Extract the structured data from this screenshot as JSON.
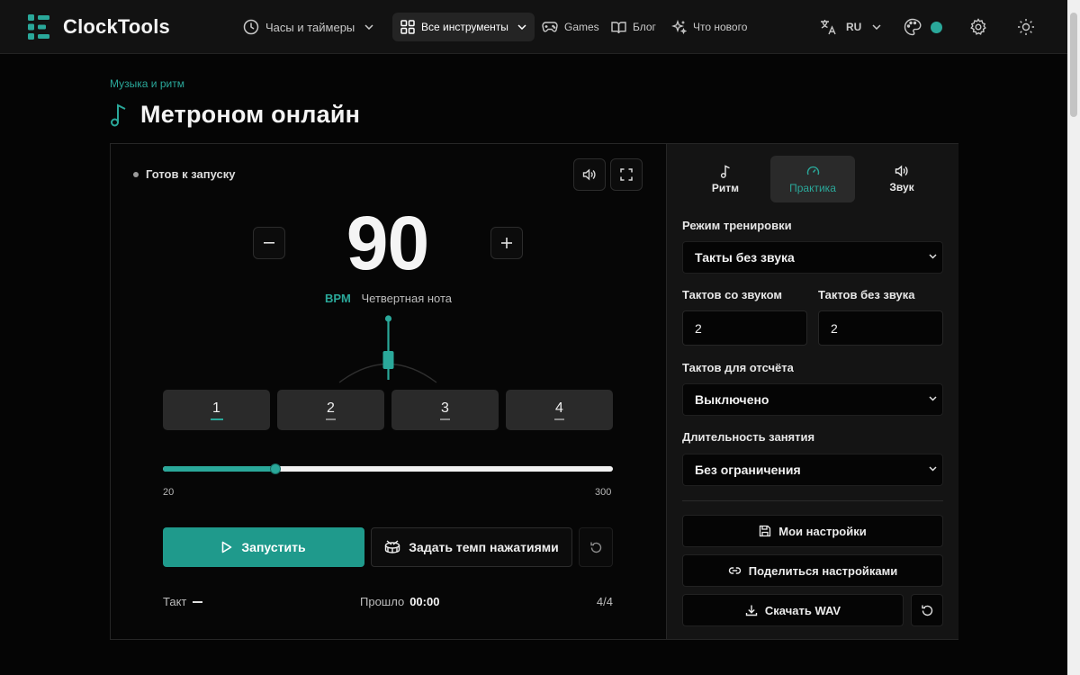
{
  "app": {
    "name": "ClockTools",
    "accent_color": "#2aa89a"
  },
  "nav": {
    "clocks": "Часы и таймеры",
    "all_tools": "Все инструменты",
    "games": "Games",
    "blog": "Блог",
    "whats_new": "Что нового",
    "language": "RU"
  },
  "page": {
    "breadcrumb": "Музыка и ритм",
    "title": "Метроном онлайн"
  },
  "metronome": {
    "status": "Готов к запуску",
    "bpm": "90",
    "bpm_unit": "BPM",
    "note_value": "Четвертная нота",
    "beats": [
      "1",
      "2",
      "3",
      "4"
    ],
    "active_beat": 1,
    "tempo_min": "20",
    "tempo_max": "300",
    "tempo_value": 90,
    "start_label": "Запустить",
    "tap_label": "Задать темп нажатиями",
    "bar_label": "Такт",
    "elapsed_label": "Прошло",
    "elapsed_value": "00:00",
    "time_signature": "4/4"
  },
  "tabs": [
    {
      "label": "Ритм",
      "icon": "music-note-icon"
    },
    {
      "label": "Практика",
      "icon": "gauge-icon"
    },
    {
      "label": "Звук",
      "icon": "speaker-icon"
    }
  ],
  "active_tab": "Практика",
  "practice": {
    "mode_label": "Режим тренировки",
    "mode_value": "Такты без звука",
    "sound_bars_label": "Тактов со звуком",
    "sound_bars_value": "2",
    "silent_bars_label": "Тактов без звука",
    "silent_bars_value": "2",
    "count_in_label": "Тактов для отсчёта",
    "count_in_value": "Выключено",
    "duration_label": "Длительность занятия",
    "duration_value": "Без ограничения"
  },
  "actions": {
    "my_settings": "Мои настройки",
    "share_settings": "Поделиться настройками",
    "download_wav": "Скачать WAV"
  }
}
